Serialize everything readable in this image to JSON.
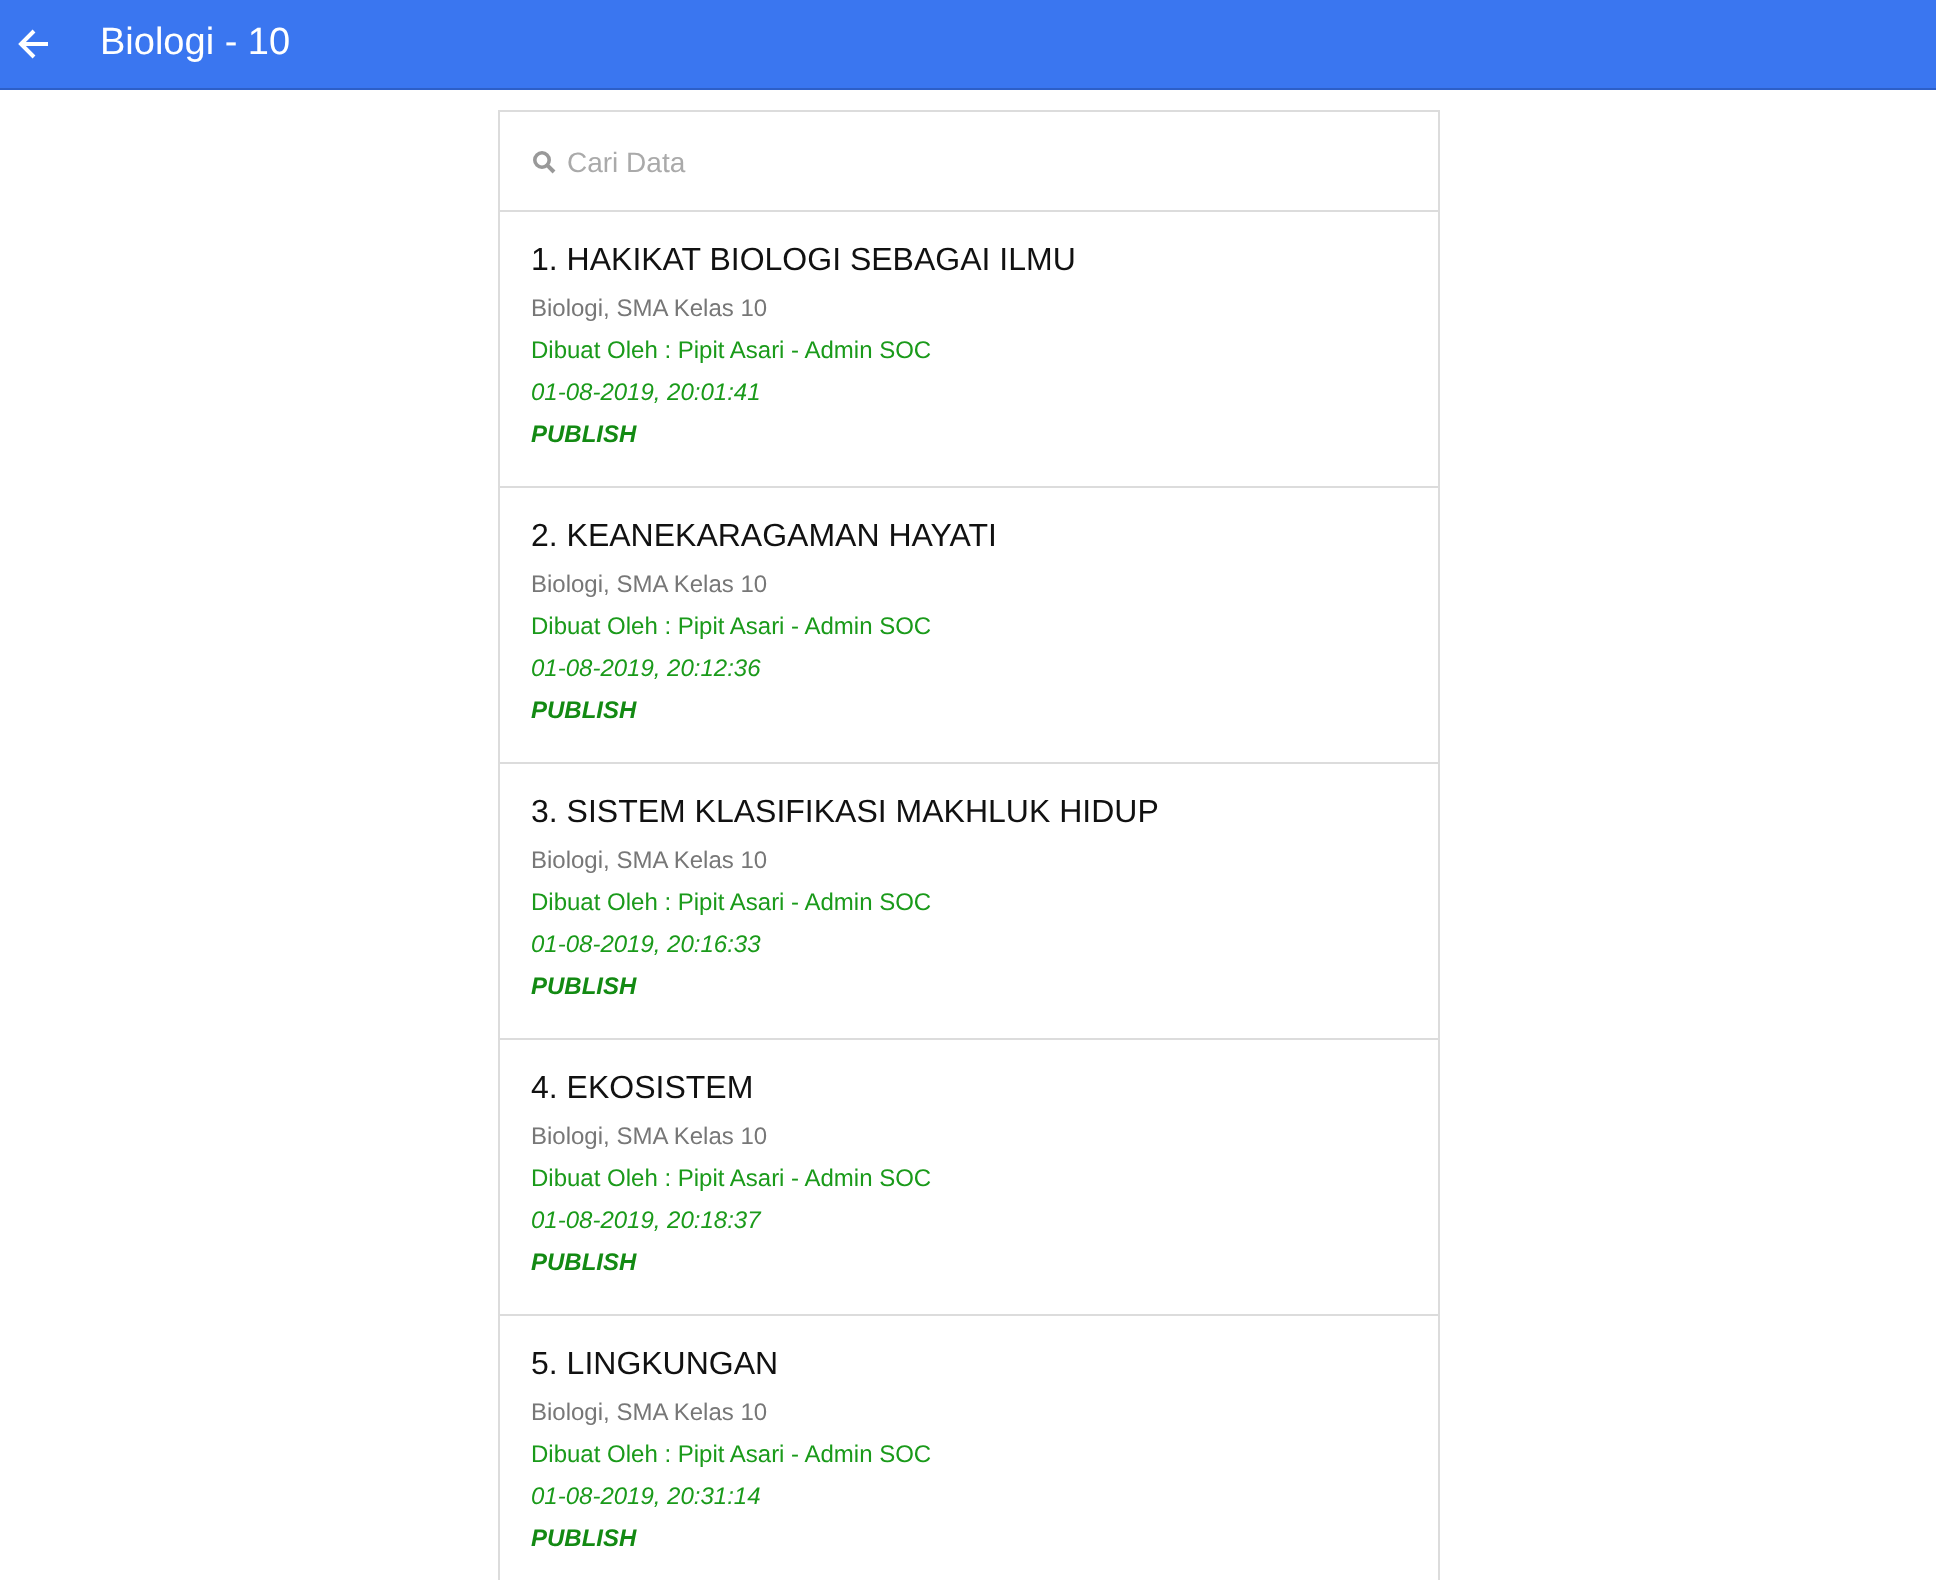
{
  "app_bar": {
    "title": "Biologi - 10"
  },
  "search": {
    "placeholder": "Cari Data"
  },
  "items": [
    {
      "title": "1. HAKIKAT BIOLOGI SEBAGAI ILMU",
      "subject": "Biologi, SMA Kelas 10",
      "author": "Dibuat Oleh : Pipit Asari - Admin SOC",
      "date": "01-08-2019, 20:01:41",
      "status": "PUBLISH"
    },
    {
      "title": "2. KEANEKARAGAMAN HAYATI",
      "subject": "Biologi, SMA Kelas 10",
      "author": "Dibuat Oleh : Pipit Asari - Admin SOC",
      "date": "01-08-2019, 20:12:36",
      "status": "PUBLISH"
    },
    {
      "title": "3. SISTEM KLASIFIKASI MAKHLUK HIDUP",
      "subject": "Biologi, SMA Kelas 10",
      "author": "Dibuat Oleh : Pipit Asari - Admin SOC",
      "date": "01-08-2019, 20:16:33",
      "status": "PUBLISH"
    },
    {
      "title": "4. EKOSISTEM",
      "subject": "Biologi, SMA Kelas 10",
      "author": "Dibuat Oleh : Pipit Asari - Admin SOC",
      "date": "01-08-2019, 20:18:37",
      "status": "PUBLISH"
    },
    {
      "title": "5. LINGKUNGAN",
      "subject": "Biologi, SMA Kelas 10",
      "author": "Dibuat Oleh : Pipit Asari - Admin SOC",
      "date": "01-08-2019, 20:31:14",
      "status": "PUBLISH"
    }
  ]
}
